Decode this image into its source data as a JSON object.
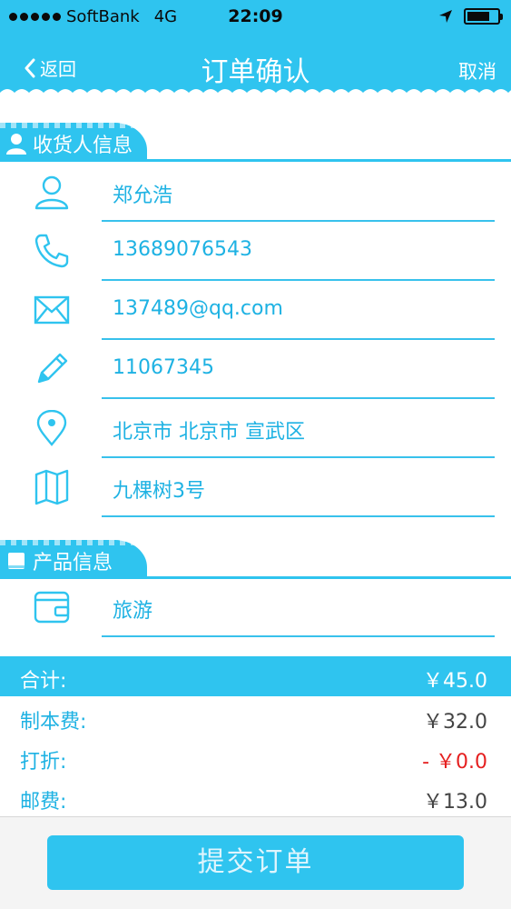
{
  "status_bar": {
    "carrier": "SoftBank",
    "network": "4G",
    "time": "22:09",
    "battery_level": 0.75
  },
  "nav": {
    "back_label": "返回",
    "title": "订单确认",
    "cancel_label": "取消"
  },
  "consignee_section": {
    "title": "收货人信息",
    "rows": [
      {
        "icon": "person-icon",
        "value": "郑允浩"
      },
      {
        "icon": "phone-icon",
        "value": "13689076543"
      },
      {
        "icon": "mail-icon",
        "value": "137489@qq.com"
      },
      {
        "icon": "pencil-icon",
        "value": "11067345"
      },
      {
        "icon": "location-pin-icon",
        "value": "北京市 北京市 宣武区"
      },
      {
        "icon": "map-icon",
        "value": "九棵树3号"
      }
    ]
  },
  "product_section": {
    "title": "产品信息",
    "rows": [
      {
        "icon": "wallet-icon",
        "value": "旅游"
      }
    ]
  },
  "summary": {
    "total_label": "合计:",
    "total_value": "￥45.0",
    "fees": [
      {
        "label": "制本费:",
        "value": "￥32.0"
      },
      {
        "label": "打折:",
        "value": "- ￥0.0"
      },
      {
        "label": "邮费:",
        "value": "￥13.0"
      }
    ]
  },
  "submit_label": "提交订单",
  "colors": {
    "accent": "#2fc4ef",
    "text_blue": "#1eb2e3",
    "discount_red": "#e52020"
  }
}
